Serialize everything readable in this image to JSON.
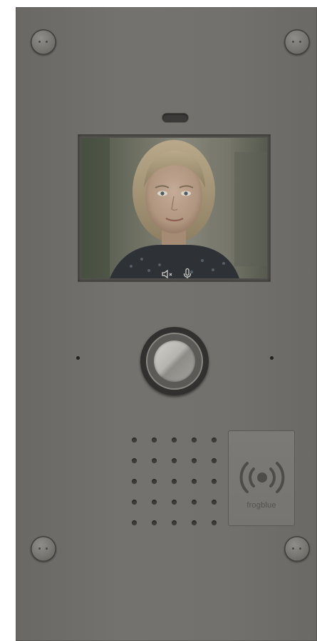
{
  "device": {
    "screen": {
      "overlay_icons": [
        "speaker-muted-icon",
        "microphone-icon"
      ]
    },
    "rfid_reader": {
      "icon": "rfid-wireless-icon",
      "label": "frogblue"
    },
    "colors": {
      "panel": "#73716d",
      "screen_bezel": "#55534f",
      "call_button_ring": "#2d2c2b",
      "indicator_led": "#222120"
    }
  }
}
